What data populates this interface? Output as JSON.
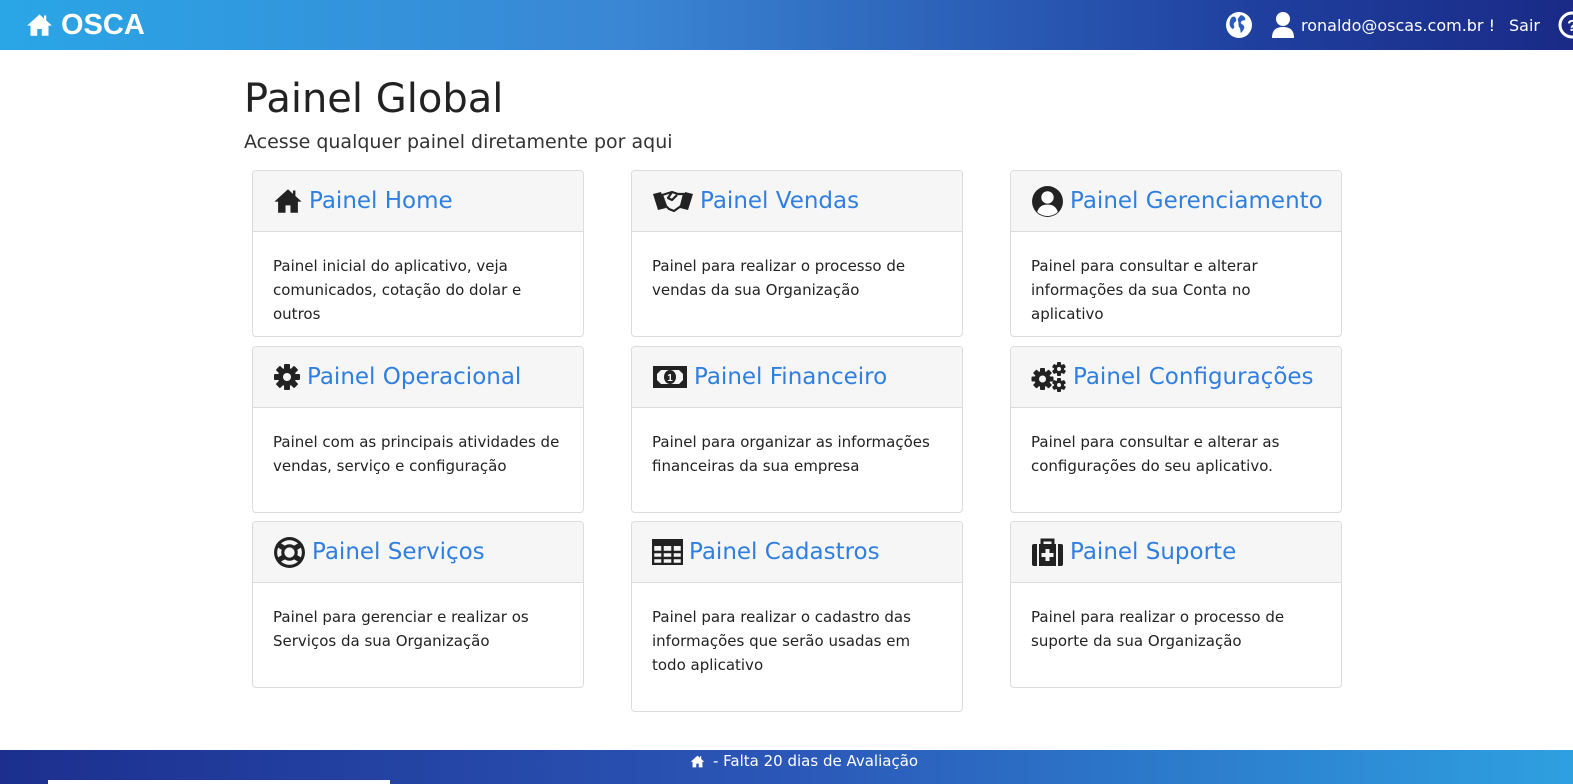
{
  "app": {
    "brand": "OSCA"
  },
  "header": {
    "user_email": "ronaldo@oscas.com.br !",
    "logout_label": "Sair"
  },
  "page": {
    "title": "Painel Global",
    "subtitle": "Acesse qualquer painel diretamente por aqui"
  },
  "panels": [
    {
      "title": "Painel Home",
      "icon": "home-icon",
      "description": "Painel inicial do aplicativo, veja comunicados, cotação do dolar e outros"
    },
    {
      "title": "Painel Vendas",
      "icon": "handshake-icon",
      "description": "Painel para realizar o processo de vendas da sua Organização"
    },
    {
      "title": "Painel Gerenciamento",
      "icon": "user-circle-icon",
      "description": "Painel para consultar e alterar informações da sua Conta no aplicativo"
    },
    {
      "title": "Painel Operacional",
      "icon": "gear-icon",
      "description": "Painel com as principais atividades de vendas, serviço e configuração"
    },
    {
      "title": "Painel Financeiro",
      "icon": "money-bill-icon",
      "description": "Painel para organizar as informações financeiras da sua empresa"
    },
    {
      "title": "Painel Configurações",
      "icon": "gears-icon",
      "description": "Painel para consultar e alterar as configurações do seu aplicativo."
    },
    {
      "title": "Painel Serviços",
      "icon": "life-ring-icon",
      "description": "Painel para gerenciar e realizar os Serviços da sua Organização"
    },
    {
      "title": "Painel Cadastros",
      "icon": "table-icon",
      "description": "Painel para realizar o cadastro das informações que serão usadas em todo aplicativo"
    },
    {
      "title": "Painel Suporte",
      "icon": "medkit-icon",
      "description": "Painel para realizar o processo de suporte da sua Organização"
    }
  ],
  "footer": {
    "text": "- Falta 20 dias de Avaliação"
  }
}
